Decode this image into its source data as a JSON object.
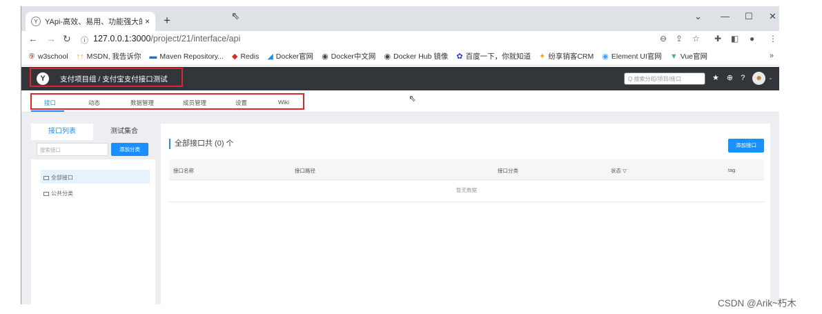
{
  "browser": {
    "tab_title": "YApi-高效、易用、功能强大的可",
    "tab_close": "×",
    "new_tab": "+",
    "window_controls": [
      "⌄",
      "—",
      "☐",
      "✕"
    ],
    "url_host": "127.0.0.1:3000",
    "url_path": "/project/21/interface/api",
    "bookmarks": [
      {
        "label": "w3school",
        "icon": "w3school-icon",
        "glyph": "⑨",
        "color": "#c9302c"
      },
      {
        "label": "MSDN, 我告诉你",
        "icon": "msdn-icon",
        "glyph": "↑↑",
        "color": "#e6a817"
      },
      {
        "label": "Maven Repository...",
        "icon": "maven-icon",
        "glyph": "▬",
        "color": "#2a6ebb"
      },
      {
        "label": "Redis",
        "icon": "redis-icon",
        "glyph": "◆",
        "color": "#d82c20"
      },
      {
        "label": "Docker官网",
        "icon": "docker-icon",
        "glyph": "◢",
        "color": "#1d91e6"
      },
      {
        "label": "Docker中文网",
        "icon": "docker-cn-icon",
        "glyph": "◉",
        "color": "#444444"
      },
      {
        "label": "Docker Hub 镜像",
        "icon": "dockerhub-icon",
        "glyph": "◉",
        "color": "#444444"
      },
      {
        "label": "百度一下，你就知道",
        "icon": "baidu-icon",
        "glyph": "✿",
        "color": "#2932e1"
      },
      {
        "label": "纷享销客CRM",
        "icon": "crm-icon",
        "glyph": "✦",
        "color": "#f2a20c"
      },
      {
        "label": "Element UI官网",
        "icon": "element-icon",
        "glyph": "◉",
        "color": "#409eff"
      },
      {
        "label": "Vue官网",
        "icon": "vue-icon",
        "glyph": "▼",
        "color": "#41b883"
      }
    ],
    "bookmarks_more": "»"
  },
  "yapi": {
    "logo": "Y",
    "breadcrumb": "支付项目组 / 支付宝支付接口测试",
    "search_placeholder": "Q 搜索分组/项目/接口",
    "header_icons": "★ ⊕ ?",
    "avatar": "☻",
    "subnav": [
      "接口",
      "动态",
      "数据管理",
      "成员管理",
      "设置",
      "Wiki"
    ],
    "sidebar": {
      "tabs": [
        "接口列表",
        "测试集合"
      ],
      "search_placeholder": "搜索接口",
      "add_category": "添加分类",
      "items": [
        "全部接口",
        "公共分类"
      ]
    },
    "main": {
      "title": "全部接口共 (0) 个",
      "add_button": "添加接口",
      "columns": [
        "接口名称",
        "接口路径",
        "接口分类",
        "状态 ▽",
        "tag"
      ],
      "empty_text": "暂无数据"
    }
  },
  "watermark": "CSDN @Arik~朽木",
  "colors": {
    "accent": "#1890ff",
    "header_bg": "#32363a",
    "highlight_border": "#e3232c"
  }
}
